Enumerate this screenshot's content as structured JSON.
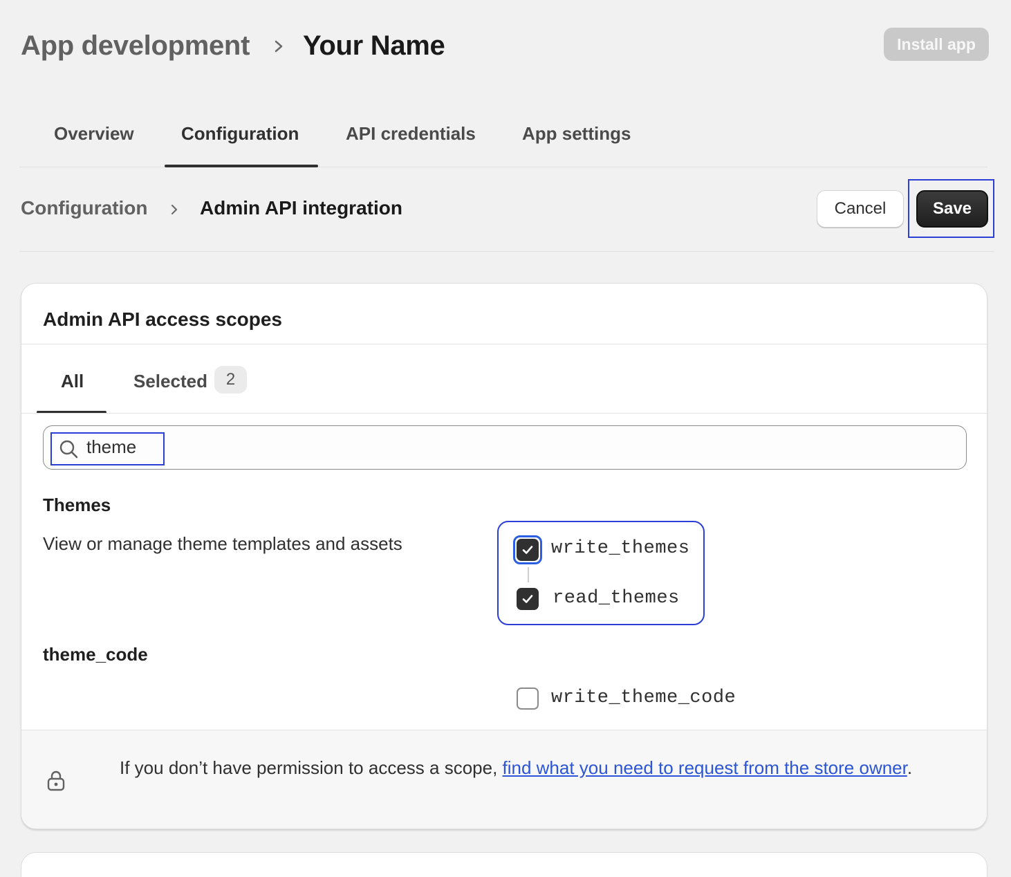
{
  "header": {
    "breadcrumb_parent": "App development",
    "breadcrumb_current": "Your Name",
    "install_label": "Install app"
  },
  "tabs": [
    {
      "label": "Overview"
    },
    {
      "label": "Configuration"
    },
    {
      "label": "API credentials"
    },
    {
      "label": "App settings"
    }
  ],
  "subheader": {
    "breadcrumb_parent": "Configuration",
    "breadcrumb_current": "Admin API integration",
    "cancel_label": "Cancel",
    "save_label": "Save"
  },
  "card": {
    "title": "Admin API access scopes",
    "filter_tabs": {
      "all_label": "All",
      "selected_label": "Selected",
      "selected_count": "2"
    },
    "search": {
      "value": "theme",
      "icon": "search-icon"
    },
    "groups": [
      {
        "title": "Themes",
        "description": "View or manage theme templates and assets",
        "scopes": [
          {
            "name": "write_themes",
            "checked": true
          },
          {
            "name": "read_themes",
            "checked": true
          }
        ]
      },
      {
        "title": "theme_code",
        "description": "",
        "scopes": [
          {
            "name": "write_theme_code",
            "checked": false
          }
        ]
      }
    ],
    "footer": {
      "text_before": "If you don’t have permission to access a scope, ",
      "link_text": "find what you need to request from the store owner",
      "text_after": ".",
      "icon": "lock-icon"
    }
  },
  "colors": {
    "accent_focus": "#2b3fd6",
    "link": "#2b55d6",
    "primary_button": "#303030"
  }
}
